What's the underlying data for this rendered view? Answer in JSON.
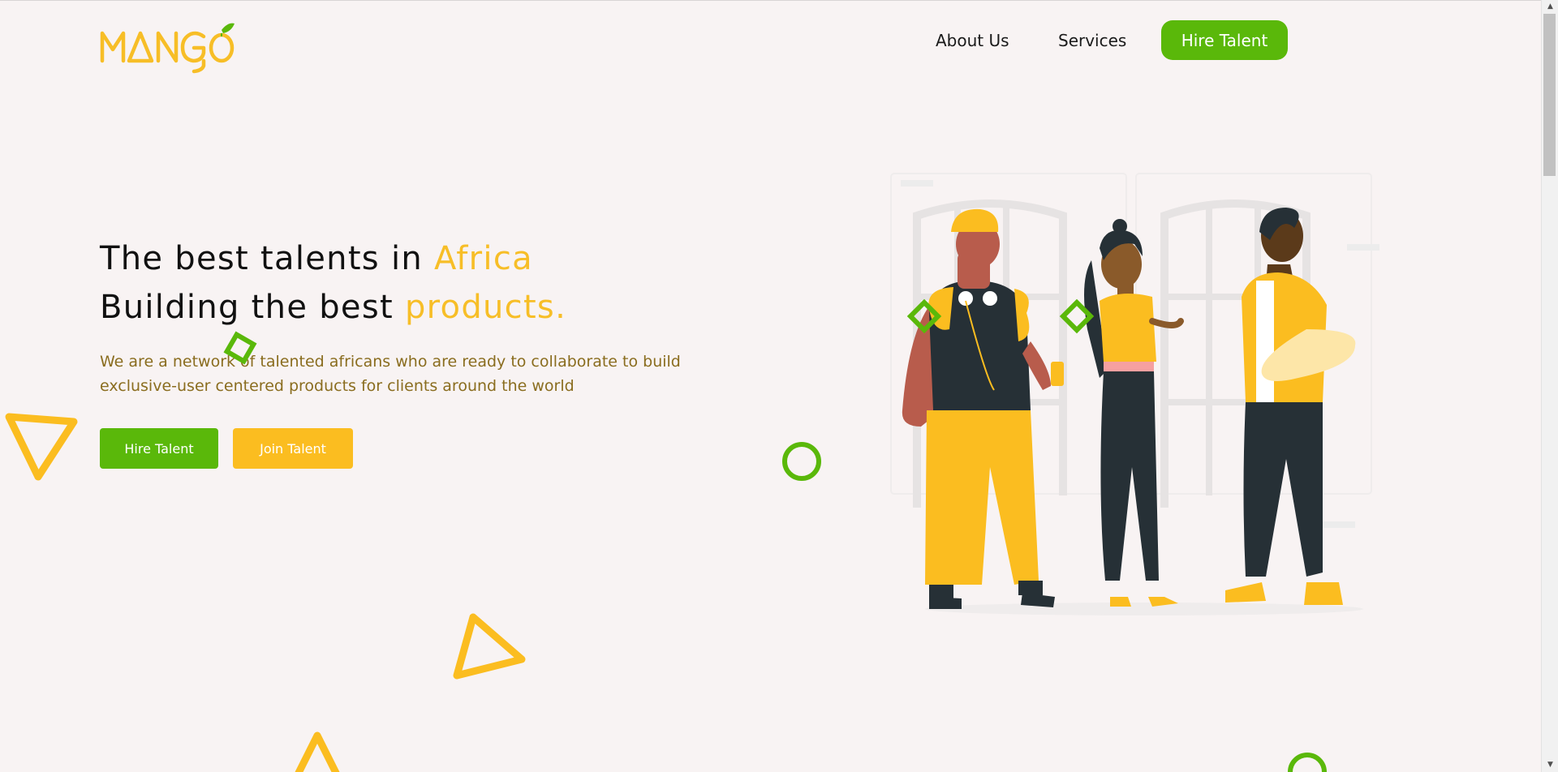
{
  "brand": {
    "logo_text": "MANGO",
    "primary": "#f7be27",
    "green": "#5ab80a"
  },
  "nav": {
    "about_label": "About Us",
    "services_label": "Services",
    "hire_label": "Hire Talent"
  },
  "hero": {
    "line1_prefix": "The best talents in ",
    "line1_accent": "Africa",
    "line2_prefix": "Building the best ",
    "line2_accent": "products.",
    "subtext": "We are a network of talented africans who are ready to collaborate to build exclusive-user centered products for clients around the world",
    "hire_button": "Hire Talent",
    "join_button": "Join Talent"
  },
  "icons": {
    "logo": "mango-leaf-logo",
    "illustration": "three-people-illustration",
    "decor": [
      "triangle-outline",
      "diamond-outline",
      "circle-outline"
    ]
  }
}
